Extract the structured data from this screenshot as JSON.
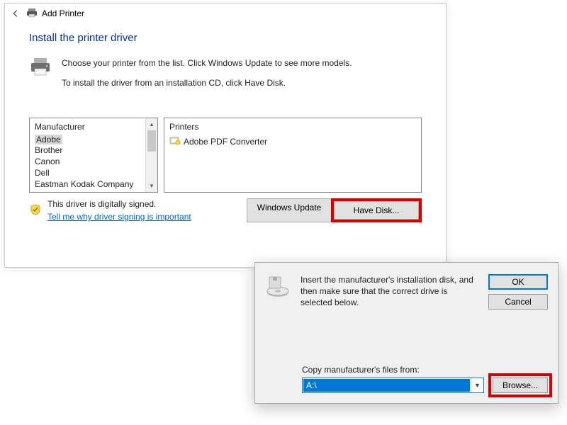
{
  "wizard": {
    "title": "Add Printer",
    "heading": "Install the printer driver",
    "intro_line1": "Choose your printer from the list. Click Windows Update to see more models.",
    "intro_line2": "To install the driver from an installation CD, click Have Disk.",
    "manufacturer_header": "Manufacturer",
    "printers_header": "Printers",
    "manufacturers": [
      "Adobe",
      "Brother",
      "Canon",
      "Dell",
      "Eastman Kodak Company"
    ],
    "selected_manufacturer_index": 0,
    "printers": [
      "Adobe PDF Converter"
    ],
    "signed_text": "This driver is digitally signed.",
    "signing_link": "Tell me why driver signing is important",
    "windows_update_btn": "Windows Update",
    "have_disk_btn": "Have Disk..."
  },
  "disk_dialog": {
    "instruction": "Insert the manufacturer's installation disk, and then make sure that the correct drive is selected below.",
    "ok_btn": "OK",
    "cancel_btn": "Cancel",
    "copy_label": "Copy manufacturer's files from:",
    "combo_value": "A:\\",
    "browse_btn": "Browse..."
  }
}
